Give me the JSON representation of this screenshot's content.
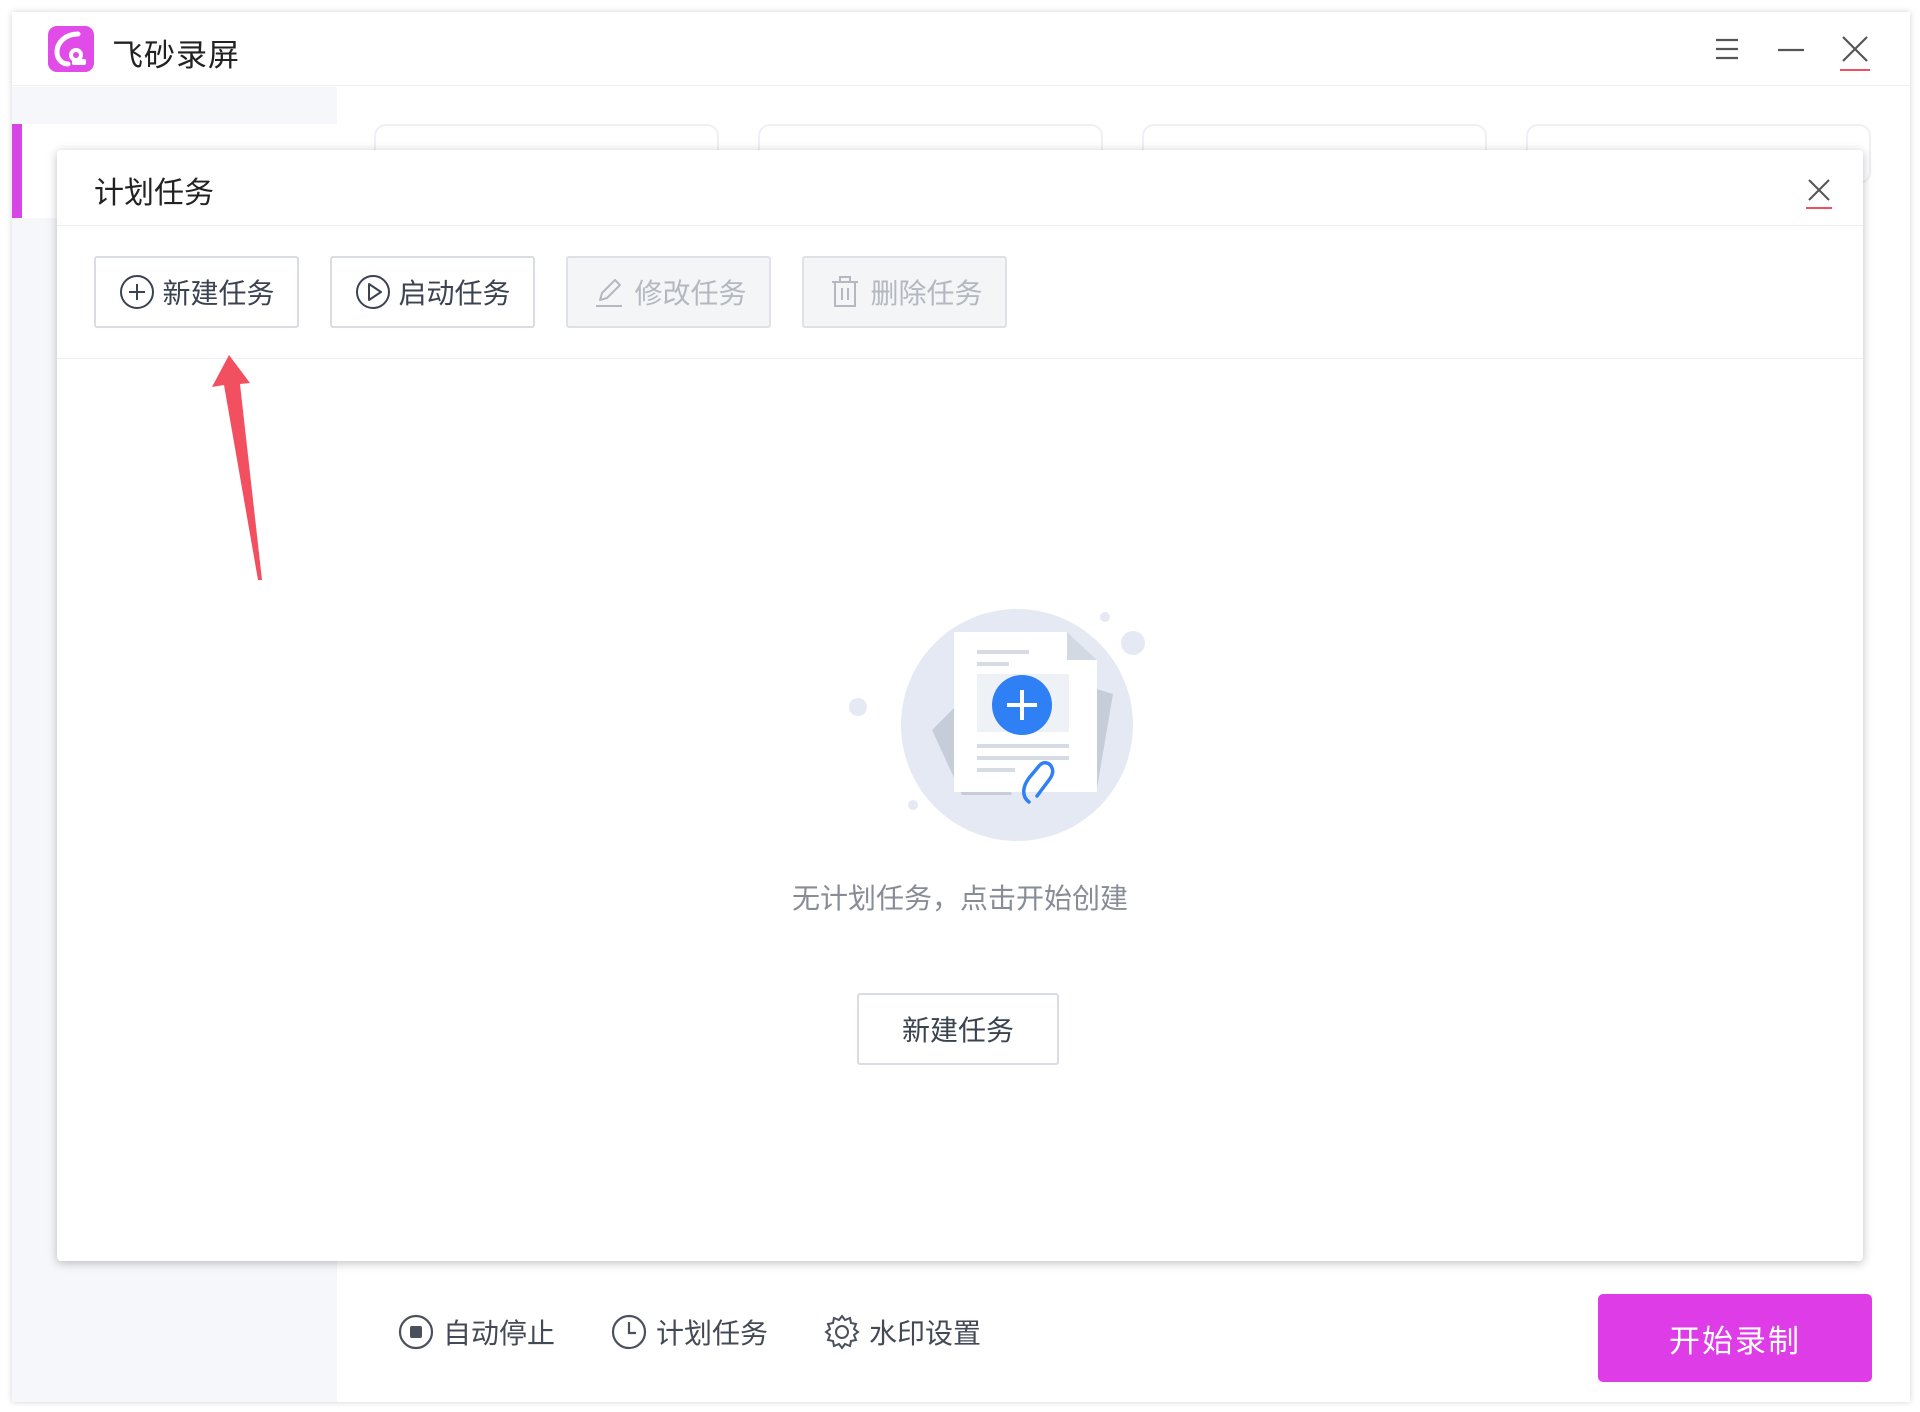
{
  "app": {
    "title": "飞砂录屏"
  },
  "footer": {
    "auto_stop": "自动停止",
    "scheduled_task": "计划任务",
    "watermark": "水印设置",
    "start_record": "开始录制"
  },
  "dialog": {
    "title": "计划任务",
    "toolbar": {
      "new_task": "新建任务",
      "start_task": "启动任务",
      "edit_task": "修改任务",
      "delete_task": "删除任务"
    },
    "empty_state": {
      "message": "无计划任务，点击开始创建",
      "button": "新建任务"
    }
  },
  "colors": {
    "accent": "#dd3ce6",
    "primary_blue": "#2f7ff5",
    "annotation_arrow": "#f25060"
  }
}
